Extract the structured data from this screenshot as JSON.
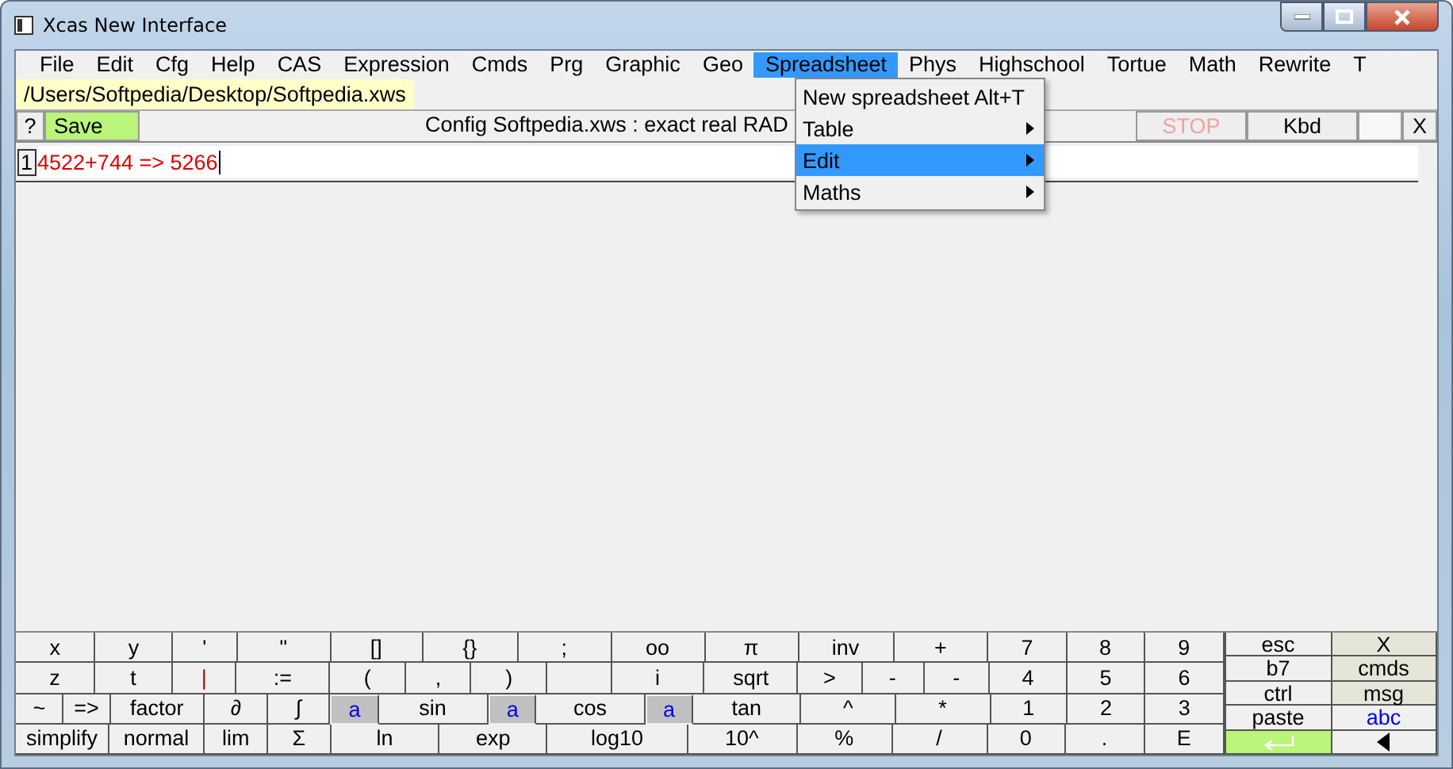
{
  "window": {
    "title": "Xcas New Interface"
  },
  "menu_bar": [
    {
      "label": "File",
      "selected": false
    },
    {
      "label": "Edit",
      "selected": false
    },
    {
      "label": "Cfg",
      "selected": false
    },
    {
      "label": "Help",
      "selected": false
    },
    {
      "label": "CAS",
      "selected": false
    },
    {
      "label": "Expression",
      "selected": false
    },
    {
      "label": "Cmds",
      "selected": false
    },
    {
      "label": "Prg",
      "selected": false
    },
    {
      "label": "Graphic",
      "selected": false
    },
    {
      "label": "Geo",
      "selected": false
    },
    {
      "label": "Spreadsheet",
      "selected": true
    },
    {
      "label": "Phys",
      "selected": false
    },
    {
      "label": "Highschool",
      "selected": false
    },
    {
      "label": "Tortue",
      "selected": false
    },
    {
      "label": "Math",
      "selected": false
    },
    {
      "label": "Rewrite",
      "selected": false
    },
    {
      "label": "T",
      "selected": false
    }
  ],
  "file_tab": {
    "label": "/Users/Softpedia/Desktop/Softpedia.xws"
  },
  "toolbar": {
    "help": "?",
    "save": "Save",
    "config": "Config Softpedia.xws : exact real RAD",
    "stop": {
      "label": "STOP",
      "disabled": true
    },
    "kbd": "Kbd",
    "close": "X"
  },
  "entries": [
    {
      "number": "1",
      "text": "4522+744 => 5266"
    }
  ],
  "dropdown": [
    {
      "label": "New spreadsheet Alt+T",
      "selected": false,
      "submenu": false
    },
    {
      "label": "Table",
      "selected": false,
      "submenu": true
    },
    {
      "label": "Edit",
      "selected": true,
      "submenu": true
    },
    {
      "label": "Maths",
      "selected": false,
      "submenu": true
    }
  ],
  "keypad": [
    [
      {
        "label": "x",
        "kind": "key"
      },
      {
        "label": "y",
        "kind": "key"
      },
      {
        "label": "'",
        "kind": "key"
      },
      {
        "label": "\"",
        "kind": "key"
      },
      {
        "label": "[]",
        "kind": "key"
      },
      {
        "label": "{}",
        "kind": "key"
      },
      {
        "label": ";",
        "kind": "key"
      },
      {
        "label": "oo",
        "kind": "key"
      },
      {
        "label": "π",
        "kind": "key"
      },
      {
        "label": "inv",
        "kind": "key"
      },
      {
        "label": "+",
        "kind": "key"
      },
      {
        "label": "7",
        "kind": "key"
      },
      {
        "label": "8",
        "kind": "key"
      },
      {
        "label": "9",
        "kind": "key"
      }
    ],
    [
      {
        "label": "z",
        "kind": "key"
      },
      {
        "label": "t",
        "kind": "key"
      },
      {
        "label": "|",
        "kind": "red"
      },
      {
        "label": ":=",
        "kind": "key"
      },
      {
        "label": "(",
        "kind": "key"
      },
      {
        "label": ",",
        "kind": "key"
      },
      {
        "label": ")",
        "kind": "key"
      },
      {
        "kind": "blank"
      },
      {
        "label": "i",
        "kind": "key"
      },
      {
        "label": "sqrt",
        "kind": "key"
      },
      {
        "label": ">",
        "kind": "key"
      },
      {
        "label": "-",
        "kind": "key"
      },
      {
        "label": "-",
        "kind": "key"
      },
      {
        "label": "4",
        "kind": "key"
      },
      {
        "label": "5",
        "kind": "key"
      },
      {
        "label": "6",
        "kind": "key"
      }
    ],
    [
      {
        "label": "~",
        "kind": "key"
      },
      {
        "label": "=>",
        "kind": "key"
      },
      {
        "label": "factor",
        "kind": "key"
      },
      {
        "label": "∂",
        "kind": "key"
      },
      {
        "label": "∫",
        "kind": "key"
      },
      {
        "label": "a",
        "kind": "var"
      },
      {
        "label": "sin",
        "kind": "key"
      },
      {
        "label": "a",
        "kind": "var"
      },
      {
        "label": "cos",
        "kind": "key"
      },
      {
        "label": "a",
        "kind": "var"
      },
      {
        "label": "tan",
        "kind": "key"
      },
      {
        "label": "^",
        "kind": "key"
      },
      {
        "label": "*",
        "kind": "key"
      },
      {
        "label": "1",
        "kind": "key"
      },
      {
        "label": "2",
        "kind": "key"
      },
      {
        "label": "3",
        "kind": "key"
      }
    ],
    [
      {
        "label": "simplify",
        "kind": "key"
      },
      {
        "label": "normal",
        "kind": "key"
      },
      {
        "label": "lim",
        "kind": "key"
      },
      {
        "label": "Σ",
        "kind": "key"
      },
      {
        "label": "ln",
        "kind": "key"
      },
      {
        "label": "exp",
        "kind": "key"
      },
      {
        "label": "log10",
        "kind": "key"
      },
      {
        "label": "10^",
        "kind": "key"
      },
      {
        "label": "%",
        "kind": "key"
      },
      {
        "label": "/",
        "kind": "key"
      },
      {
        "label": "0",
        "kind": "key"
      },
      {
        "label": ".",
        "kind": "key"
      },
      {
        "label": "E",
        "kind": "key"
      }
    ]
  ],
  "side_keys": [
    [
      {
        "label": "esc",
        "kind": "key"
      },
      {
        "label": "X",
        "kind": "panel"
      }
    ],
    [
      {
        "label": "b7",
        "kind": "key"
      },
      {
        "label": "cmds",
        "kind": "panel"
      }
    ],
    [
      {
        "label": "ctrl",
        "kind": "key"
      },
      {
        "label": "msg",
        "kind": "panel"
      }
    ],
    [
      {
        "label": "paste",
        "kind": "key"
      },
      {
        "label": "abc",
        "kind": "link"
      }
    ],
    [
      {
        "kind": "enter"
      },
      {
        "kind": "back"
      }
    ]
  ]
}
